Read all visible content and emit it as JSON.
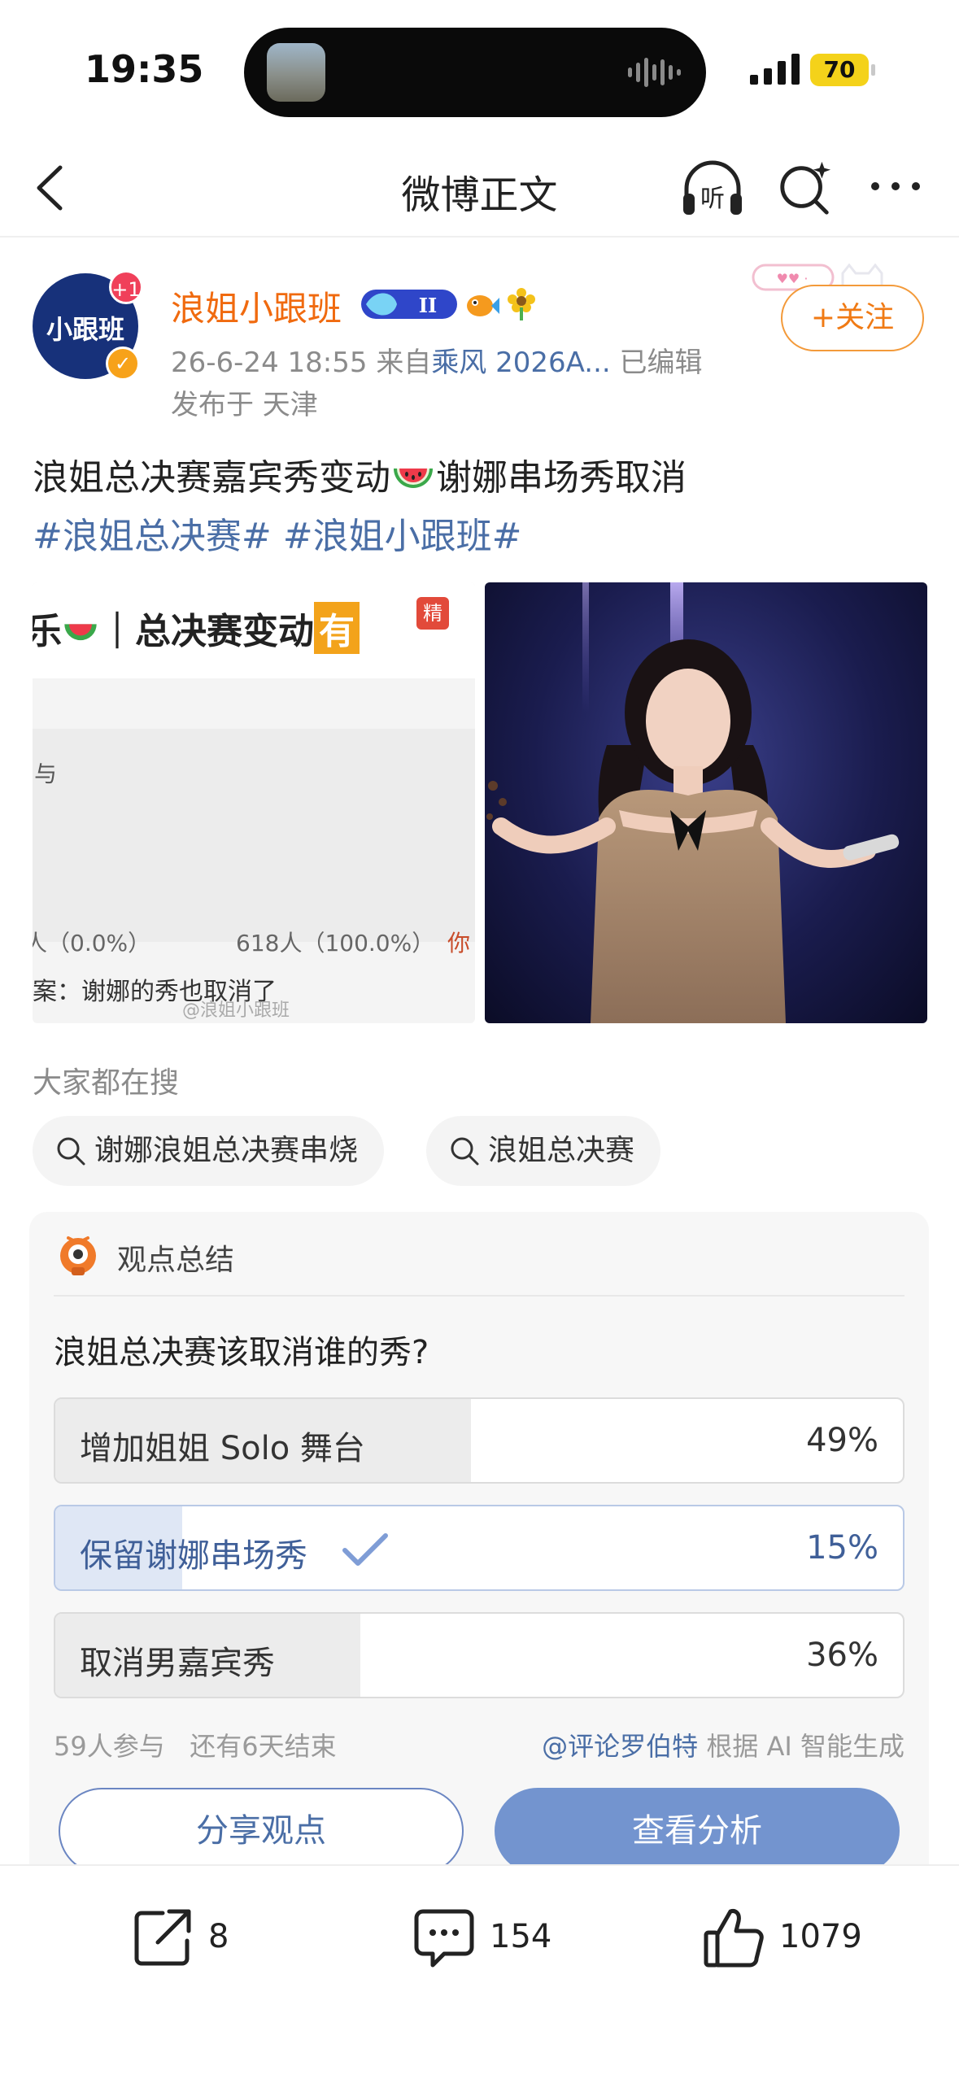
{
  "status_bar": {
    "time": "19:35",
    "battery": "70"
  },
  "nav": {
    "title": "微博正文"
  },
  "post": {
    "author": {
      "avatar_text": "小跟班",
      "avatar_badge": "+1",
      "name": "浪姐小跟班",
      "follow_label": "+关注"
    },
    "meta": {
      "timestamp": "26-6-24 18:55",
      "from_prefix": "来自",
      "source": "乘风 2026A...",
      "edited": "已编辑",
      "location": "发布于 天津"
    },
    "text_before_emoji": "浪姐总决赛嘉宾秀变动",
    "text_after_emoji": "谢娜串场秀取消",
    "hashtag1": "#浪姐总决赛#",
    "hashtag2": "#浪姐小跟班#",
    "image1": {
      "header_left": "乐",
      "header_main": "｜总决赛变动",
      "header_badge": "有",
      "jing": "精",
      "yu": "与",
      "result_left": "人（0.0%）",
      "result_mid": "618人（100.0%）",
      "result_right": "你",
      "answer": "案：谢娜的秀也取消了",
      "watermark": "@浪姐小跟班"
    }
  },
  "hot_search": {
    "title": "大家都在搜",
    "chips": [
      "谢娜浪姐总决赛串烧",
      "浪姐总决赛"
    ]
  },
  "poll": {
    "section_label": "观点总结",
    "question": "浪姐总决赛该取消谁的秀?",
    "options": [
      {
        "label": "增加姐姐 Solo 舞台",
        "percent": "49%",
        "value": 49,
        "selected": false
      },
      {
        "label": "保留谢娜串场秀",
        "percent": "15%",
        "value": 15,
        "selected": true
      },
      {
        "label": "取消男嘉宾秀",
        "percent": "36%",
        "value": 36,
        "selected": false
      }
    ],
    "participants": "59人参与",
    "remaining": "还有6天结束",
    "credit_at": "@评论罗伯特",
    "credit_text": "根据 AI 智能生成",
    "share_button": "分享观点",
    "view_button": "查看分析"
  },
  "toolbar": {
    "share_count": "8",
    "comment_count": "154",
    "like_count": "1079"
  }
}
